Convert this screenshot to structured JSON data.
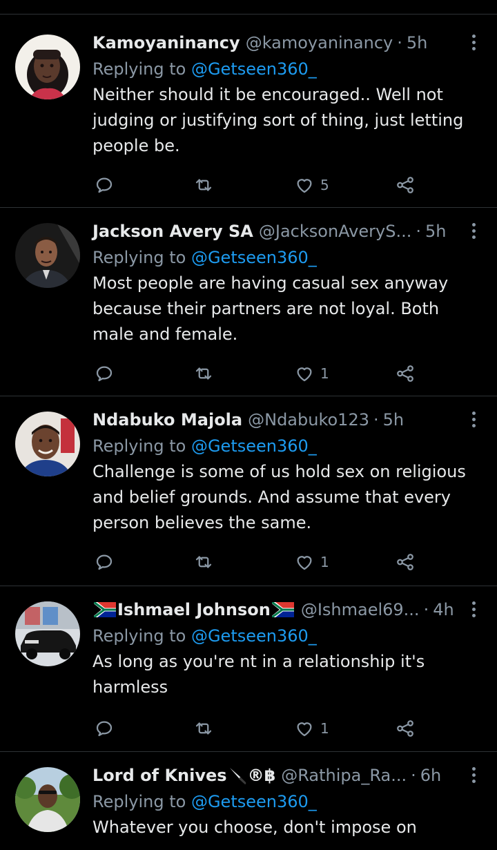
{
  "tweets": [
    {
      "name": "Kamoyaninancy",
      "handle": "@kamoyaninancy",
      "time": "5h",
      "replying_prefix": "Replying to",
      "replying_to": "@Getseen360_",
      "text": "Neither should it be encouraged.. Well  not judging or justifying sort of thing, just letting people be.",
      "likes": "5",
      "avatar_icon": "avatar-woman"
    },
    {
      "name": "Jackson Avery SA",
      "handle": "@JacksonAveryS...",
      "time": "5h",
      "replying_prefix": "Replying to",
      "replying_to": "@Getseen360_",
      "text": "Most people are having casual sex anyway because their partners are not loyal. Both male and female.",
      "likes": "1",
      "avatar_icon": "avatar-man-suit"
    },
    {
      "name": "Ndabuko Majola",
      "handle": "@Ndabuko123",
      "time": "5h",
      "replying_prefix": "Replying to",
      "replying_to": "@Getseen360_",
      "text": "Challenge is some of us hold sex on religious and belief grounds. And assume that every person believes the same.",
      "likes": "1",
      "avatar_icon": "avatar-man-smile"
    },
    {
      "name": "Ishmael Johnson",
      "name_flag": "south-africa-flag",
      "handle": "@Ishmael69...",
      "time": "4h",
      "replying_prefix": "Replying to",
      "replying_to": "@Getseen360_",
      "text": "As long as you're nt in a relationship it's harmless",
      "likes": "1",
      "avatar_icon": "avatar-car"
    },
    {
      "name": "Lord of Knives",
      "name_suffix": "®฿",
      "name_emoji": "knife",
      "handle": "@Rathipa_Ra...",
      "time": "6h",
      "replying_prefix": "Replying to",
      "replying_to": "@Getseen360_",
      "text": "Whatever you choose, don't impose on",
      "avatar_icon": "avatar-man-outdoors"
    }
  ],
  "separator": "·",
  "icons": {
    "reply": "reply-icon",
    "retweet": "retweet-icon",
    "like": "heart-icon",
    "share": "share-icon",
    "more": "more-options-icon"
  },
  "colors": {
    "background": "#000000",
    "text": "#e7e9ea",
    "secondary": "#8b98a5",
    "accent": "#1d9bf0",
    "divider": "#2f3336"
  }
}
